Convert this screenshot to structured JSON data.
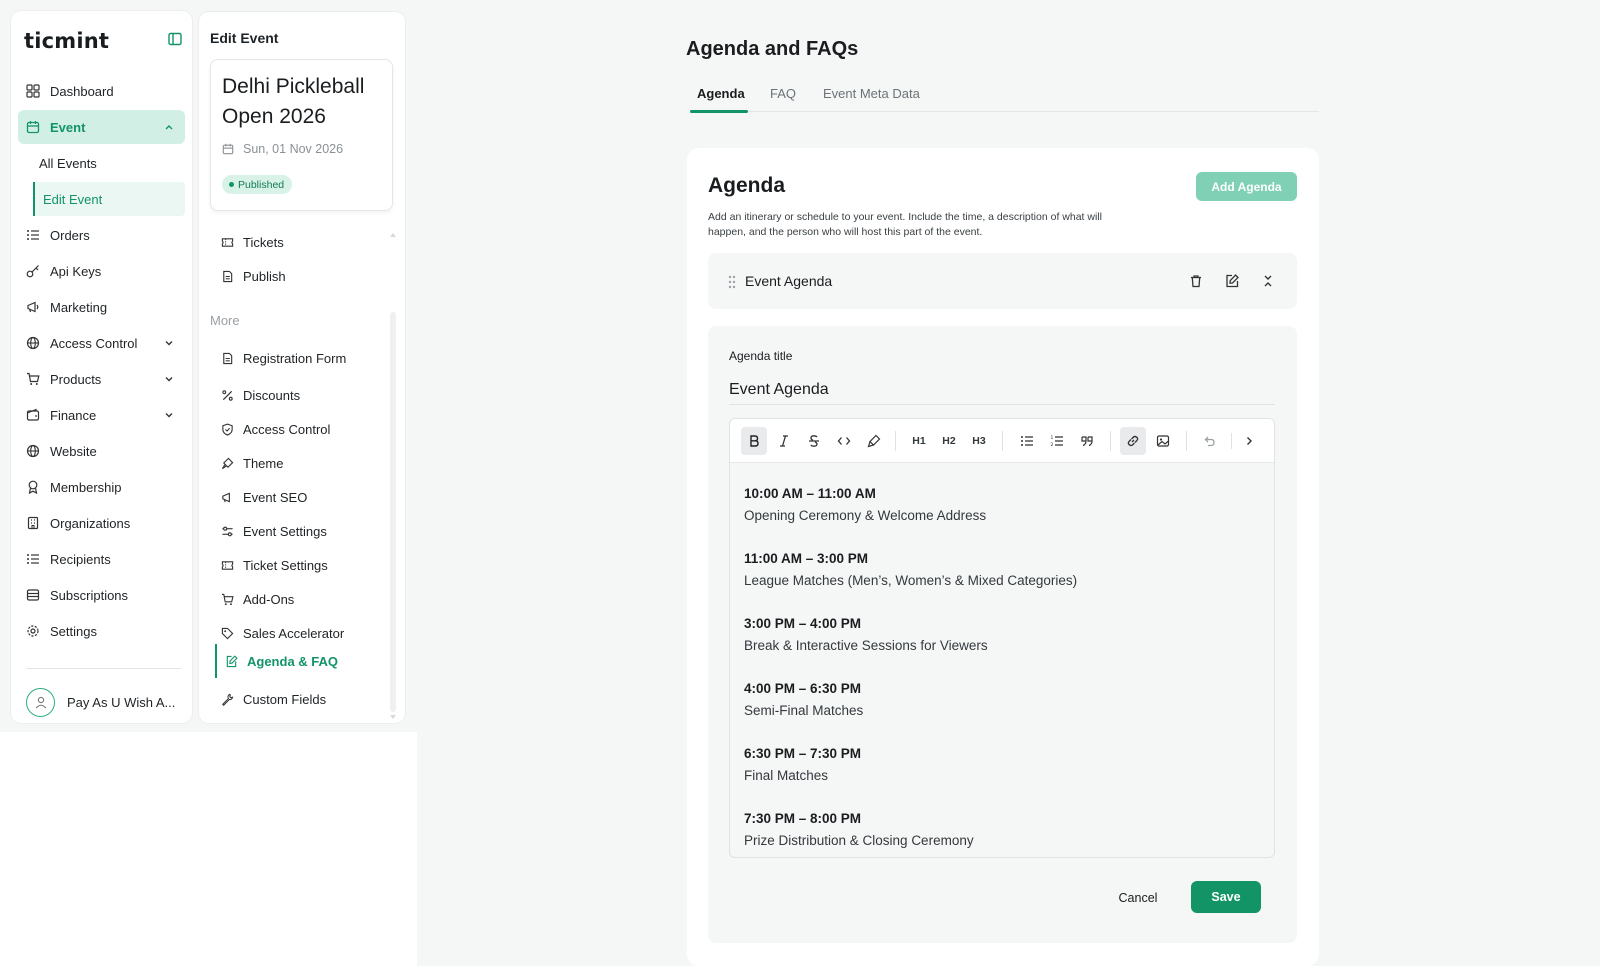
{
  "sidebar": {
    "logo": "ticmint",
    "items": [
      {
        "label": "Dashboard"
      },
      {
        "label": "Event"
      },
      {
        "label": "All Events"
      },
      {
        "label": "Edit Event"
      },
      {
        "label": "Orders"
      },
      {
        "label": "Api Keys"
      },
      {
        "label": "Marketing"
      },
      {
        "label": "Access Control"
      },
      {
        "label": "Products"
      },
      {
        "label": "Finance"
      },
      {
        "label": "Website"
      },
      {
        "label": "Membership"
      },
      {
        "label": "Organizations"
      },
      {
        "label": "Recipients"
      },
      {
        "label": "Subscriptions"
      },
      {
        "label": "Settings"
      }
    ],
    "user": "Pay As U Wish A..."
  },
  "edit_panel": {
    "title": "Edit Event",
    "event_name": "Delhi Pickleball Open 2026",
    "event_date": "Sun, 01 Nov 2026",
    "status": "Published",
    "more_label": "More",
    "items": [
      {
        "label": "Tickets"
      },
      {
        "label": "Publish"
      },
      {
        "label": "Registration Form"
      },
      {
        "label": "Discounts"
      },
      {
        "label": "Access Control"
      },
      {
        "label": "Theme"
      },
      {
        "label": "Event SEO"
      },
      {
        "label": "Event Settings"
      },
      {
        "label": "Ticket Settings"
      },
      {
        "label": "Add-Ons"
      },
      {
        "label": "Sales Accelerator"
      },
      {
        "label": "Agenda & FAQ"
      },
      {
        "label": "Custom Fields"
      }
    ]
  },
  "main": {
    "page_title": "Agenda and FAQs",
    "tabs": [
      {
        "label": "Agenda"
      },
      {
        "label": "FAQ"
      },
      {
        "label": "Event Meta Data"
      }
    ],
    "agenda_heading": "Agenda",
    "agenda_description": "Add an itinerary or schedule to your event. Include the time, a description of what will happen, and the person who will host this part of the event.",
    "add_button": "Add Agenda",
    "agenda_item_title": "Event Agenda",
    "form": {
      "field_label": "Agenda title",
      "title_value": "Event Agenda",
      "toolbar": {
        "h1": "H1",
        "h2": "H2",
        "h3": "H3"
      },
      "content": [
        {
          "time": "10:00 AM – 11:00 AM",
          "desc": "Opening Ceremony & Welcome Address"
        },
        {
          "time": "11:00 AM – 3:00 PM",
          "desc": "League Matches (Men’s, Women’s & Mixed Categories)"
        },
        {
          "time": "3:00 PM – 4:00 PM",
          "desc": "Break & Interactive Sessions for Viewers"
        },
        {
          "time": "4:00 PM – 6:30 PM",
          "desc": "Semi-Final Matches"
        },
        {
          "time": "6:30 PM – 7:30 PM",
          "desc": "Final Matches"
        },
        {
          "time": "7:30 PM – 8:00 PM",
          "desc": "Prize Distribution & Closing Ceremony"
        }
      ],
      "cancel": "Cancel",
      "save": "Save"
    }
  },
  "colors": {
    "accent": "#129467",
    "accent_light": "#d2efe5",
    "add_button": "#7fd0b4"
  }
}
